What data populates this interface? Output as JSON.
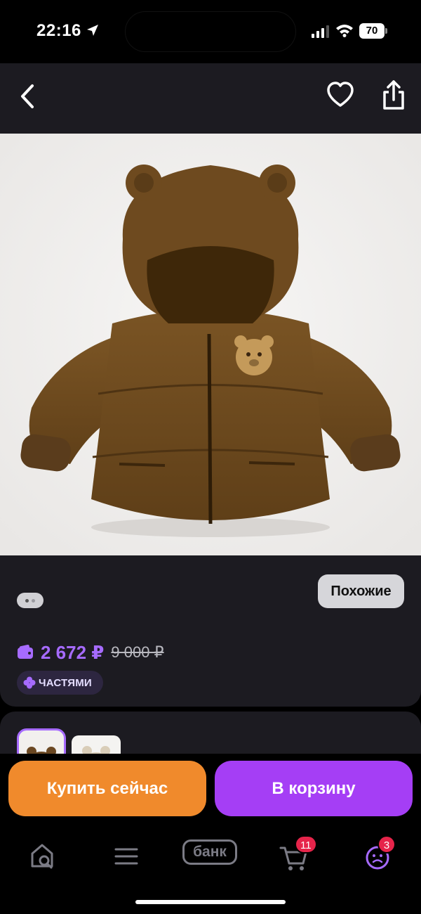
{
  "status_bar": {
    "time": "22:16",
    "battery": "70"
  },
  "top_nav": {
    "back_icon": "chevron-left-icon",
    "favorite_icon": "heart-icon",
    "share_icon": "share-icon"
  },
  "product": {
    "image_alt": "brown puffer jacket with bear ears hood and bear patch",
    "gallery_pages": 2,
    "gallery_active_index": 0
  },
  "info": {
    "similar_label": "Похожие",
    "price": "2 672 ₽",
    "old_price": "9 000 ₽",
    "parts_label": "ЧАСТЯМИ"
  },
  "actions": {
    "buy_now_label": "Купить сейчас",
    "add_to_cart_label": "В корзину"
  },
  "tab_bar": {
    "bank_label": "банк",
    "cart_badge": "11",
    "profile_badge": "3"
  },
  "colors": {
    "accent": "#a66bff",
    "buy_button": "#f08a2c",
    "cart_button": "#a53ef5",
    "badge": "#e6244a",
    "surface": "#1c1b21"
  }
}
